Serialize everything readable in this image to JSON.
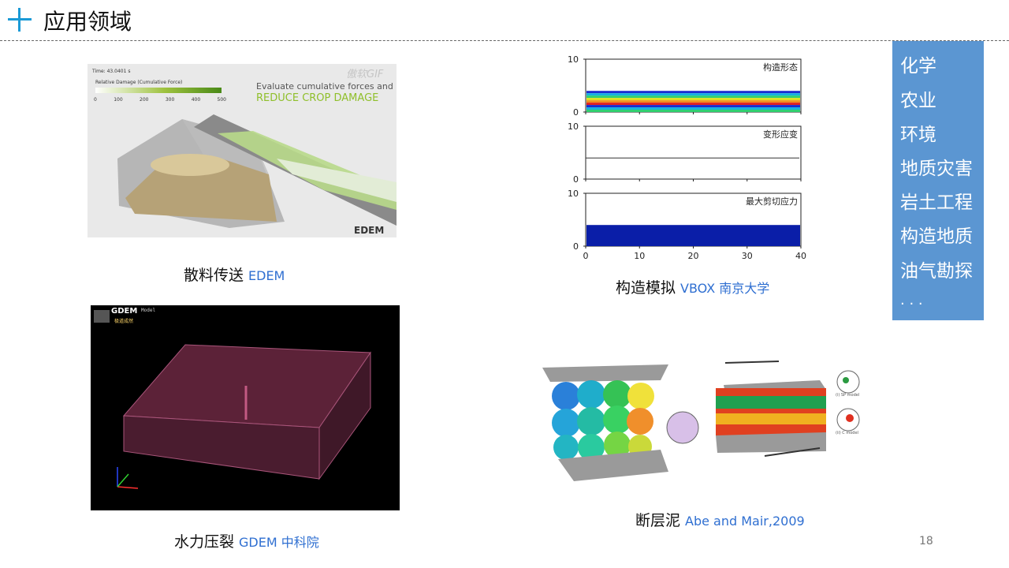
{
  "header": {
    "title": "应用领域"
  },
  "sidebar": {
    "items": [
      "化学",
      "农业",
      "环境",
      "地质灾害",
      "岩土工程",
      "构造地质",
      "油气勘探",
      ". . ."
    ]
  },
  "captions": {
    "edem": {
      "label": "散料传送",
      "source": "EDEM"
    },
    "vbox": {
      "label": "构造模拟",
      "source": "VBOX 南京大学"
    },
    "gdem": {
      "label": "水力压裂",
      "source": "GDEM 中科院"
    },
    "fault": {
      "label": "断层泥",
      "source": "Abe and Mair,2009"
    }
  },
  "edem_image": {
    "time": "Time: 43.0401 s",
    "legend_title": "Relative Damage (Cumulative Force)",
    "legend_ticks": [
      "0",
      "100",
      "200",
      "300",
      "400",
      "500"
    ],
    "text1": "Evaluate cumulative forces and",
    "text2": "REDUCE CROP DAMAGE",
    "watermark": "傲软GIF",
    "logo": "EDEM"
  },
  "gdem_image": {
    "logo": "GDEM",
    "logo_sub": "极道成然",
    "model": "Model"
  },
  "fault_image": {
    "model1": "(i) SP model",
    "model2": "(ii) C model"
  },
  "chart_data": {
    "type": "area",
    "xlim": [
      0,
      40
    ],
    "xticks": [
      "0",
      "10",
      "20",
      "30",
      "40"
    ],
    "panels": [
      {
        "label": "构造形态",
        "ylim": [
          0,
          10
        ],
        "yticks": [
          "0",
          "10"
        ],
        "layer_top": 4.0
      },
      {
        "label": "变形应变",
        "ylim": [
          0,
          10
        ],
        "yticks": [
          "0",
          "10"
        ],
        "line_value": 4.0
      },
      {
        "label": "最大剪切应力",
        "ylim": [
          0,
          10
        ],
        "yticks": [
          "0",
          "10"
        ],
        "layer_top": 4.0
      }
    ]
  },
  "colors": {
    "accent": "#1a9ad6",
    "sidebar": "#5b96d2",
    "source_text": "#2f6fd1"
  },
  "page_number": "18"
}
